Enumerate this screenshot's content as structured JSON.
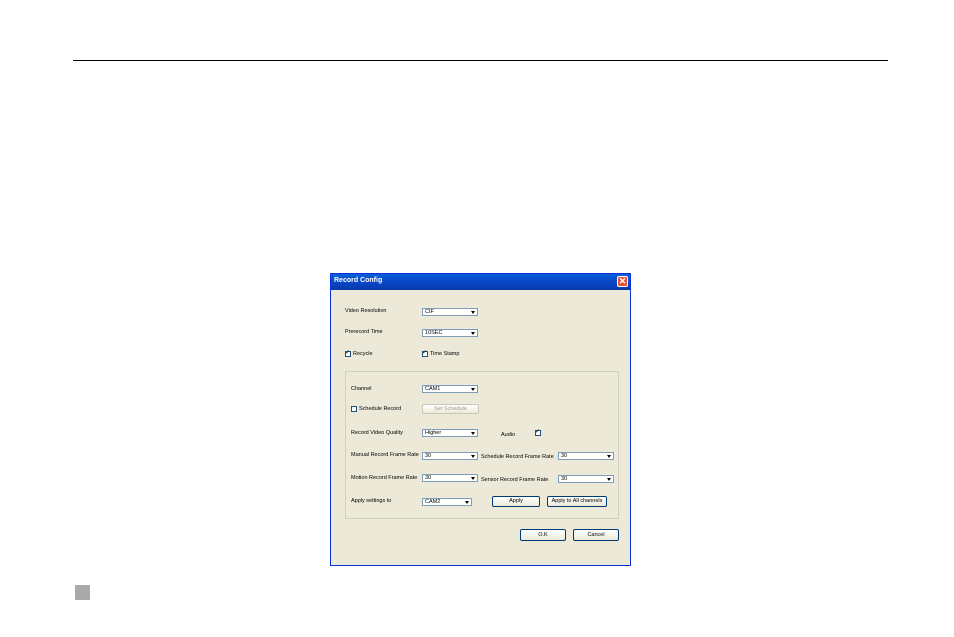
{
  "dialog": {
    "title": "Record Config",
    "video_resolution": {
      "label": "Video Resolution",
      "value": "CIF"
    },
    "prerecord_time": {
      "label": "Prerecord Time",
      "value": "10SEC"
    },
    "recycle": {
      "label": "Recycle",
      "checked": true
    },
    "time_stamp": {
      "label": "Time Stamp",
      "checked": true
    },
    "channel": {
      "label": "Channel",
      "value": "CAM1"
    },
    "schedule_record": {
      "label": "Schedule Record",
      "checked": false
    },
    "set_schedule_label": "Set Schedule",
    "record_video_quality": {
      "label": "Record Video Quality",
      "value": "Higher"
    },
    "audio": {
      "label": "Audio",
      "checked": true
    },
    "manual_frame_rate": {
      "label": "Manual Record Frame Rate",
      "value": "30"
    },
    "schedule_frame_rate": {
      "label": "Schedule Record Frame Rate",
      "value": "30"
    },
    "motion_frame_rate": {
      "label": "Motion Record Frame Rate",
      "value": "30"
    },
    "sensor_frame_rate": {
      "label": "Sensor Record Frame Rate",
      "value": "30"
    },
    "apply_settings_to": {
      "label": "Apply settings to",
      "value": "CAM2"
    },
    "apply_label": "Apply",
    "apply_all_label": "Apply to All channels",
    "ok_label": "O.K",
    "cancel_label": "Cancel",
    "check_glyph": "✓",
    "close_glyph": "✕"
  },
  "colors": {
    "titlebar": "#0843c4",
    "dialog_bg": "#ece9d8",
    "close": "#e0523a"
  }
}
